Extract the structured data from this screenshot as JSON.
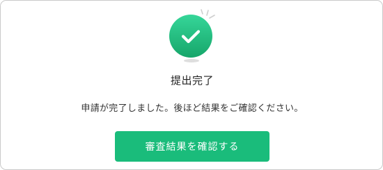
{
  "dialog": {
    "title": "提出完了",
    "message": "申請が完了しました。後ほど結果をご確認ください。",
    "primary_button_label": "審査結果を確認する"
  },
  "icons": {
    "status": "check-circle-icon",
    "decoration": "sparkle-icon"
  },
  "colors": {
    "accent": "#1abc7b",
    "icon_gradient_top": "#36d699",
    "icon_gradient_bottom": "#16a66a",
    "border": "#c9c9c9"
  }
}
